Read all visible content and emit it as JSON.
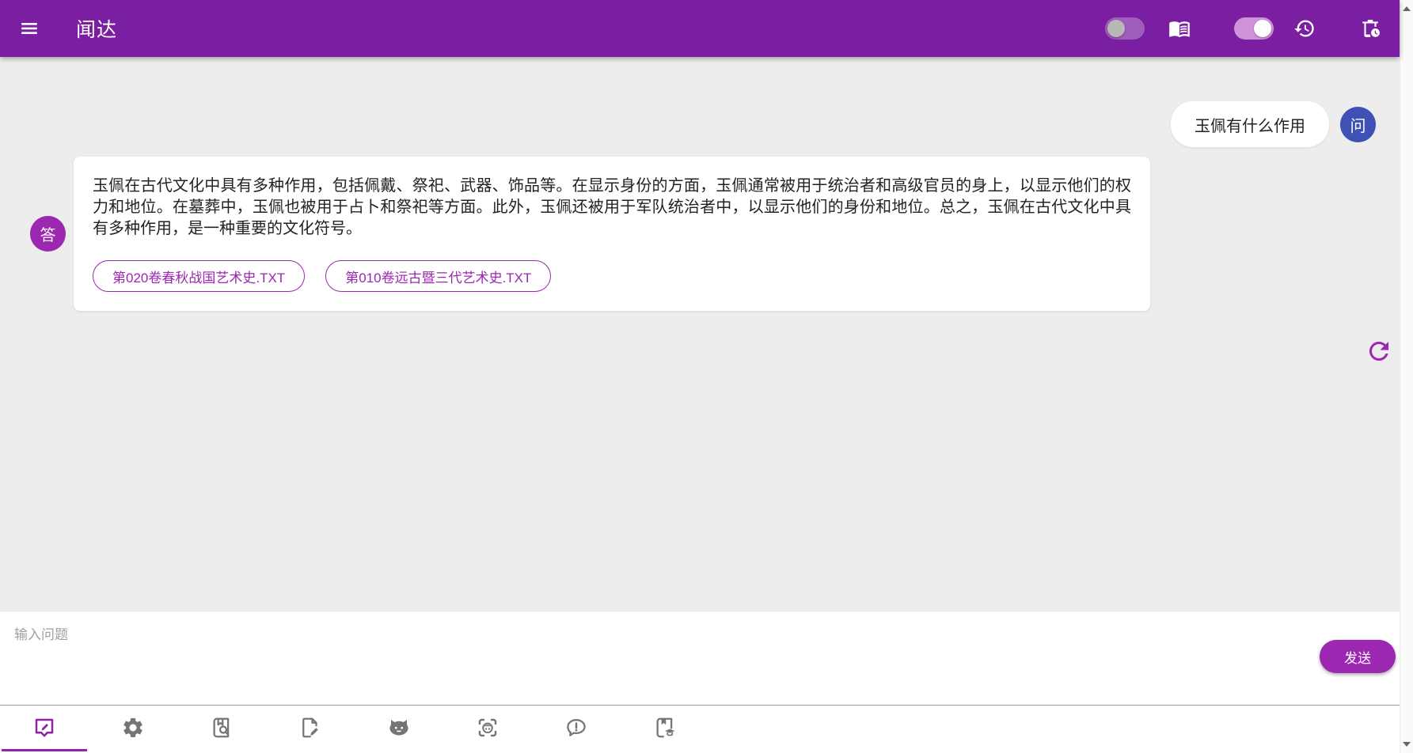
{
  "header": {
    "title": "闻达",
    "menu_icon": "hamburger-icon",
    "knowledge_toggle": {
      "name": "knowledge-toggle",
      "state": "off"
    },
    "book_icon": "open-book-icon",
    "history_toggle": {
      "name": "history-toggle",
      "state": "on"
    },
    "history_icon": "history-icon",
    "clear_history_icon": "auto-delete-icon"
  },
  "chat": {
    "question": {
      "avatar_label": "问",
      "text": "玉佩有什么作用"
    },
    "answer": {
      "avatar_label": "答",
      "text": "玉佩在古代文化中具有多种作用，包括佩戴、祭祀、武器、饰品等。在显示身份的方面，玉佩通常被用于统治者和高级官员的身上，以显示他们的权力和地位。在墓葬中，玉佩也被用于占卜和祭祀等方面。此外，玉佩还被用于军队统治者中，以显示他们的身份和地位。总之，玉佩在古代文化中具有多种作用，是一种重要的文化符号。",
      "sources": [
        {
          "label": "第020卷春秋战国艺术史.TXT"
        },
        {
          "label": "第010卷远古暨三代艺术史.TXT"
        }
      ]
    },
    "refresh_icon": "refresh-icon"
  },
  "composer": {
    "placeholder": "输入问题",
    "send_label": "发送"
  },
  "toolbar": {
    "tabs": [
      {
        "icon": "chat-edit-icon",
        "active": true
      },
      {
        "icon": "settings-gear-icon",
        "active": false
      },
      {
        "icon": "book-search-icon",
        "active": false
      },
      {
        "icon": "document-edit-icon",
        "active": false
      },
      {
        "icon": "cat-icon",
        "active": false
      },
      {
        "icon": "face-scan-icon",
        "active": false
      },
      {
        "icon": "feedback-icon",
        "active": false
      },
      {
        "icon": "book-study-icon",
        "active": false
      }
    ]
  },
  "colors": {
    "header_purple": "#7B1FA2",
    "accent_purple": "#9C27B0",
    "active_tab_purple": "#8E24AA",
    "question_avatar_indigo": "#3F51B5",
    "chat_background": "#EDEDED"
  }
}
